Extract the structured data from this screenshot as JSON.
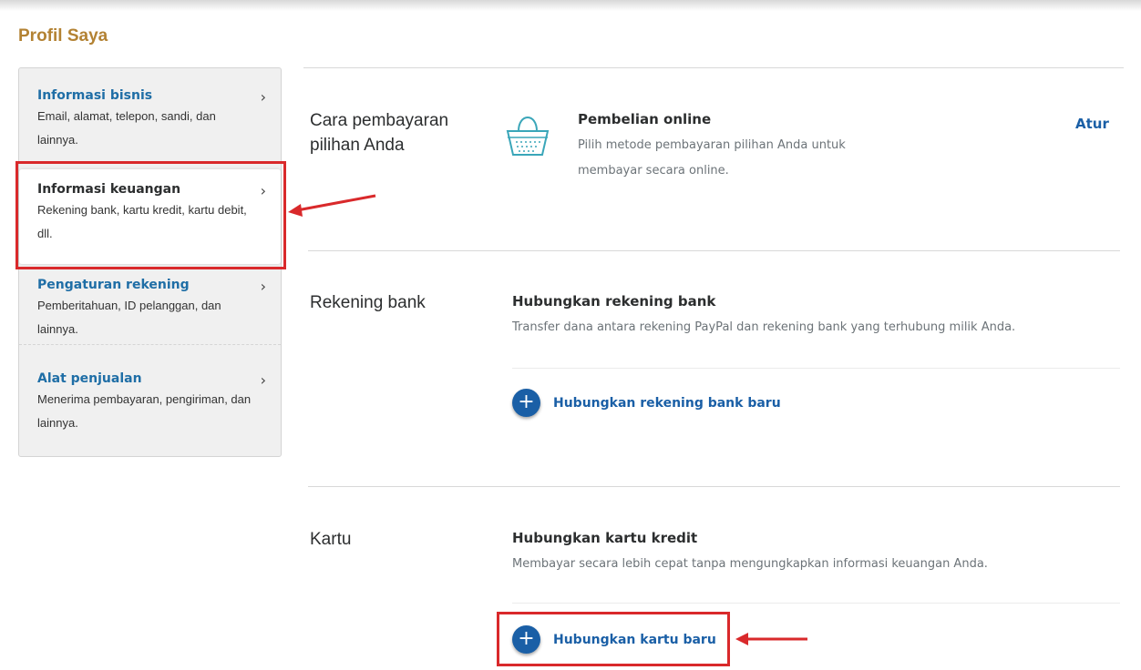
{
  "page": {
    "title": "Profil Saya"
  },
  "sidebar": {
    "items": [
      {
        "title": "Informasi bisnis",
        "desc_line1": "Email, alamat, telepon, sandi, dan",
        "desc_line2": "lainnya.",
        "chevron": "›"
      },
      {
        "title": "Informasi keuangan",
        "desc_line1": "Rekening bank, kartu kredit, kartu debit,",
        "desc_line2": "dll.",
        "chevron": "›"
      },
      {
        "title": "Pengaturan rekening",
        "desc_line1": "Pemberitahuan, ID pelanggan, dan",
        "desc_line2": "lainnya.",
        "chevron": "›"
      },
      {
        "title": "Alat penjualan",
        "desc_line1": "Menerima pembayaran, pengiriman, dan",
        "desc_line2": "lainnya.",
        "chevron": "›"
      }
    ]
  },
  "sections": {
    "payment": {
      "label_line1": "Cara pembayaran",
      "label_line2": "pilihan Anda",
      "icon": "basket-icon",
      "title": "Pembelian online",
      "desc_line1": "Pilih metode pembayaran pilihan Anda untuk",
      "desc_line2": "membayar secara online.",
      "action": "Atur"
    },
    "bank": {
      "label": "Rekening bank",
      "title": "Hubungkan rekening bank",
      "desc": "Transfer dana antara rekening PayPal dan rekening bank yang terhubung milik Anda.",
      "link": "Hubungkan rekening bank baru",
      "link_icon": "+"
    },
    "card": {
      "label": "Kartu",
      "title": "Hubungkan kartu kredit",
      "desc": "Membayar secara lebih cepat tanpa mengungkapkan informasi keuangan Anda.",
      "link": "Hubungkan kartu baru",
      "link_icon": "+"
    }
  },
  "colors": {
    "accent_blue": "#1a5fa6",
    "title_gold": "#b38233",
    "highlight_red": "#d9292b"
  }
}
